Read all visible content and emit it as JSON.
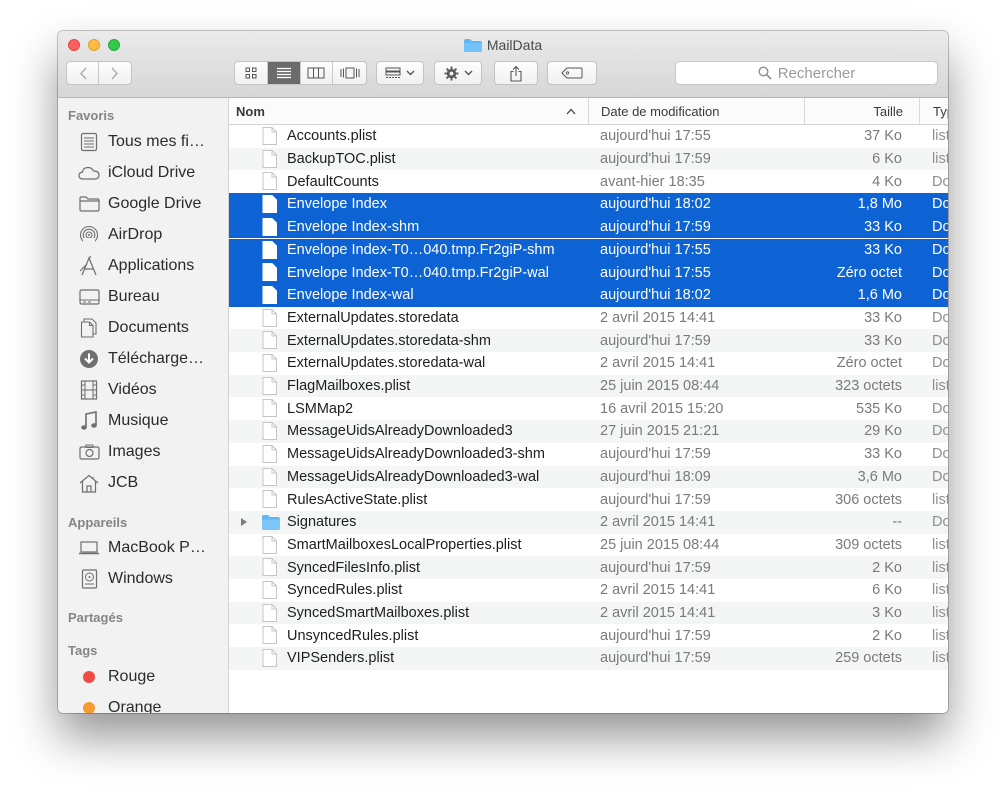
{
  "window": {
    "title": "MailData"
  },
  "toolbar": {
    "search_placeholder": "Rechercher"
  },
  "sidebar": {
    "sections": {
      "favoris": "Favoris",
      "appareils": "Appareils",
      "partages": "Partagés",
      "tags": "Tags"
    },
    "favorites": [
      {
        "label": "Tous mes fi…",
        "icon": "all-files-icon"
      },
      {
        "label": "iCloud Drive",
        "icon": "cloud-icon"
      },
      {
        "label": "Google Drive",
        "icon": "folder-icon"
      },
      {
        "label": "AirDrop",
        "icon": "airdrop-icon"
      },
      {
        "label": "Applications",
        "icon": "applications-icon"
      },
      {
        "label": "Bureau",
        "icon": "desktop-icon"
      },
      {
        "label": "Documents",
        "icon": "documents-icon"
      },
      {
        "label": "Télécharge…",
        "icon": "download-icon"
      },
      {
        "label": "Vidéos",
        "icon": "film-icon"
      },
      {
        "label": "Musique",
        "icon": "music-icon"
      },
      {
        "label": "Images",
        "icon": "camera-icon"
      },
      {
        "label": "JCB",
        "icon": "home-icon"
      }
    ],
    "devices": [
      {
        "label": "MacBook P…",
        "icon": "laptop-icon"
      },
      {
        "label": "Windows",
        "icon": "disk-icon"
      }
    ],
    "tags": [
      {
        "label": "Rouge",
        "color": "#f24b44"
      },
      {
        "label": "Orange",
        "color": "#f79a2f"
      }
    ]
  },
  "columns": {
    "name": "Nom",
    "date": "Date de modification",
    "size": "Taille",
    "kind": "Type"
  },
  "files": [
    {
      "name": "Accounts.plist",
      "date": "aujourd'hui 17:55",
      "size": "37 Ko",
      "kind": "list"
    },
    {
      "name": "BackupTOC.plist",
      "date": "aujourd'hui 17:59",
      "size": "6 Ko",
      "kind": "list"
    },
    {
      "name": "DefaultCounts",
      "date": "avant-hier 18:35",
      "size": "4 Ko",
      "kind": "Do"
    },
    {
      "name": "Envelope Index",
      "date": "aujourd'hui 18:02",
      "size": "1,8 Mo",
      "kind": "Do",
      "selected": true
    },
    {
      "name": "Envelope Index-shm",
      "date": "aujourd'hui 17:59",
      "size": "33 Ko",
      "kind": "Do",
      "selected": true
    },
    {
      "name": "Envelope Index-T0…040.tmp.Fr2giP-shm",
      "date": "aujourd'hui 17:55",
      "size": "33 Ko",
      "kind": "Do",
      "selected": true
    },
    {
      "name": "Envelope Index-T0…040.tmp.Fr2giP-wal",
      "date": "aujourd'hui 17:55",
      "size": "Zéro octet",
      "kind": "Do",
      "selected": true
    },
    {
      "name": "Envelope Index-wal",
      "date": "aujourd'hui 18:02",
      "size": "1,6 Mo",
      "kind": "Do",
      "selected": true
    },
    {
      "name": "ExternalUpdates.storedata",
      "date": "2 avril 2015 14:41",
      "size": "33 Ko",
      "kind": "Do"
    },
    {
      "name": "ExternalUpdates.storedata-shm",
      "date": "aujourd'hui 17:59",
      "size": "33 Ko",
      "kind": "Do"
    },
    {
      "name": "ExternalUpdates.storedata-wal",
      "date": "2 avril 2015 14:41",
      "size": "Zéro octet",
      "kind": "Do"
    },
    {
      "name": "FlagMailboxes.plist",
      "date": "25 juin 2015 08:44",
      "size": "323 octets",
      "kind": "list"
    },
    {
      "name": "LSMMap2",
      "date": "16 avril 2015 15:20",
      "size": "535 Ko",
      "kind": "Do"
    },
    {
      "name": "MessageUidsAlreadyDownloaded3",
      "date": "27 juin 2015 21:21",
      "size": "29 Ko",
      "kind": "Do"
    },
    {
      "name": "MessageUidsAlreadyDownloaded3-shm",
      "date": "aujourd'hui 17:59",
      "size": "33 Ko",
      "kind": "Do"
    },
    {
      "name": "MessageUidsAlreadyDownloaded3-wal",
      "date": "aujourd'hui 18:09",
      "size": "3,6 Mo",
      "kind": "Do"
    },
    {
      "name": "RulesActiveState.plist",
      "date": "aujourd'hui 17:59",
      "size": "306 octets",
      "kind": "list"
    },
    {
      "name": "Signatures",
      "date": "2 avril 2015 14:41",
      "size": "--",
      "kind": "Do",
      "folder": true
    },
    {
      "name": "SmartMailboxesLocalProperties.plist",
      "date": "25 juin 2015 08:44",
      "size": "309 octets",
      "kind": "list"
    },
    {
      "name": "SyncedFilesInfo.plist",
      "date": "aujourd'hui 17:59",
      "size": "2 Ko",
      "kind": "list"
    },
    {
      "name": "SyncedRules.plist",
      "date": "2 avril 2015 14:41",
      "size": "6 Ko",
      "kind": "list"
    },
    {
      "name": "SyncedSmartMailboxes.plist",
      "date": "2 avril 2015 14:41",
      "size": "3 Ko",
      "kind": "list"
    },
    {
      "name": "UnsyncedRules.plist",
      "date": "aujourd'hui 17:59",
      "size": "2 Ko",
      "kind": "list"
    },
    {
      "name": "VIPSenders.plist",
      "date": "aujourd'hui 17:59",
      "size": "259 octets",
      "kind": "list"
    }
  ],
  "colors": {
    "selection": "#0e63d4",
    "folder": "#5fb7f5"
  }
}
